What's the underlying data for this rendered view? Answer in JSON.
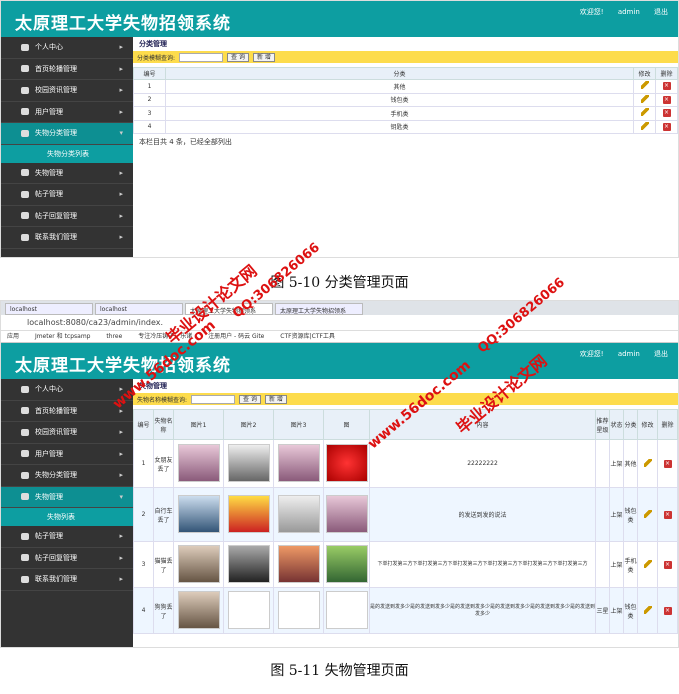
{
  "app_title": "太原理工大学失物招领系统",
  "header_links": [
    "欢迎您!",
    "admin",
    "退出"
  ],
  "sidebar": {
    "items_top": [
      "个人中心",
      "首页轮播管理",
      "校园资讯管理",
      "用户管理",
      "失物分类管理"
    ],
    "sub_category": "失物分类列表",
    "items_bottom_1": [
      "失物管理",
      "帖子管理",
      "帖子回复管理",
      "联系我们管理"
    ],
    "items_top2": [
      "个人中心",
      "首页轮播管理",
      "校园资讯管理",
      "用户管理",
      "失物分类管理",
      "失物管理"
    ],
    "sub_lost": "失物列表",
    "items_bottom_2": [
      "帖子管理",
      "帖子回复管理",
      "联系我们管理"
    ]
  },
  "s1": {
    "crumb": "分类管理",
    "query_label": "分类模糊查询:",
    "btn_query": "查 询",
    "btn_add": "新 增",
    "headers": [
      "编号",
      "分类",
      "修改",
      "删除"
    ],
    "rows": [
      [
        "1",
        "其他"
      ],
      [
        "2",
        "钱包类"
      ],
      [
        "3",
        "手机类"
      ],
      [
        "4",
        "钥匙类"
      ]
    ],
    "note": "本栏目共 4 条，已经全部列出"
  },
  "caption1": "图 5-10 分类管理页面",
  "s2": {
    "tabs": [
      "localhost",
      "localhost",
      "太原理工大学失物招领系",
      "太原理工大学失物招领系"
    ],
    "address": "localhost:8080/ca23/admin/index.",
    "bookmarks": [
      "应用",
      "Jmeter 和 tcpsamp",
      "three",
      "专注冷压铸子 - 乐诸",
      "注册用户 - 码云 Gite",
      "CTF资源库|CTF工具"
    ],
    "crumb": "失物管理",
    "query_label": "失物名称模糊查询:",
    "btn_query": "查 询",
    "btn_add": "新 增",
    "headers": [
      "编号",
      "失物名称",
      "图片1",
      "图片2",
      "图片3",
      "图",
      "内容",
      "推荐星级",
      "状态",
      "分类",
      "修改",
      "删除"
    ],
    "rows": [
      [
        "1",
        "女朋友丢了",
        "22222222",
        "",
        "上架",
        "其他"
      ],
      [
        "2",
        "自行车丢了",
        "的发送到发的说法",
        "",
        "上架",
        "钱包类"
      ],
      [
        "3",
        "猫猫丢了",
        "下单打发第三方下单打发第三方下单打发第三方下单打发第三方下单打发第三方下单打发第三方",
        "",
        "上架",
        "手机类"
      ],
      [
        "4",
        "狗狗丢了",
        "是的发送到发多少是的发送到发多少是的发送到发多少是的发送到发多少是的发送到发多少是的发送到发多少",
        "三星",
        "上架",
        "钱包类"
      ]
    ]
  },
  "caption2": "图 5-11 失物管理页面",
  "watermarks": [
    "毕业设计论文网",
    "QQ:306826066",
    "www.56doc.com"
  ]
}
